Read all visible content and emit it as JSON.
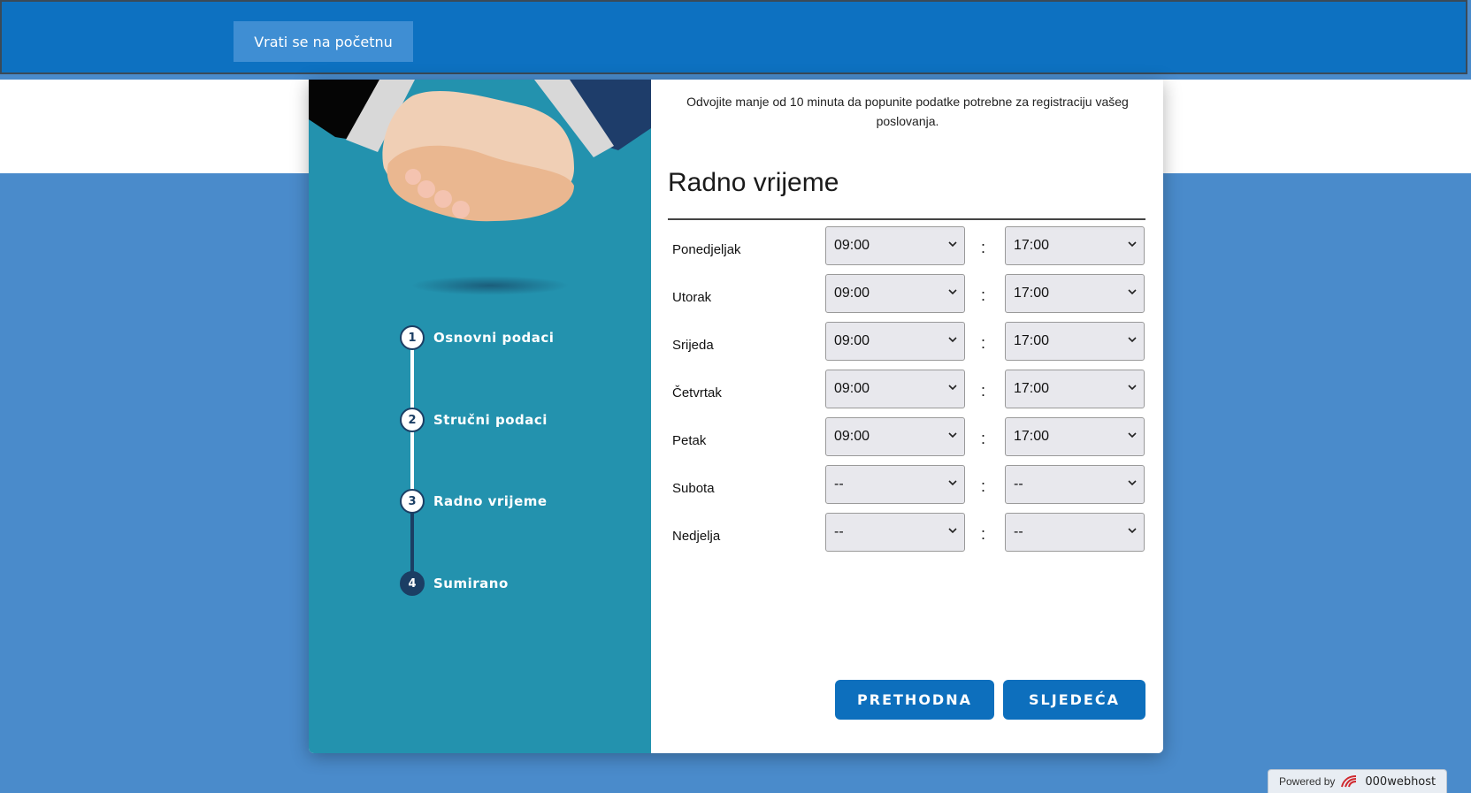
{
  "header": {
    "home_button": "Vrati se na početnu"
  },
  "steps": [
    {
      "number": "1",
      "label": "Osnovni podaci",
      "state": "done"
    },
    {
      "number": "2",
      "label": "Stručni podaci",
      "state": "done"
    },
    {
      "number": "3",
      "label": "Radno vrijeme",
      "state": "done"
    },
    {
      "number": "4",
      "label": "Sumirano",
      "state": "todo"
    }
  ],
  "form": {
    "intro": "Odvojite manje od 10 minuta da popunite podatke potrebne za registraciju vašeg poslovanja.",
    "title": "Radno vrijeme",
    "separator": ":",
    "days": [
      {
        "day": "Ponedjeljak",
        "from": "09:00",
        "to": "17:00"
      },
      {
        "day": "Utorak",
        "from": "09:00",
        "to": "17:00"
      },
      {
        "day": "Srijeda",
        "from": "09:00",
        "to": "17:00"
      },
      {
        "day": "Četvrtak",
        "from": "09:00",
        "to": "17:00"
      },
      {
        "day": "Petak",
        "from": "09:00",
        "to": "17:00"
      },
      {
        "day": "Subota",
        "from": "--",
        "to": "--"
      },
      {
        "day": "Nedjelja",
        "from": "--",
        "to": "--"
      }
    ],
    "prev_button": "PRETHODNA",
    "next_button": "SLJEDEĆA"
  },
  "footer": {
    "powered_by": "Powered by",
    "brand": "000webhost",
    "brand_icon": "000webhost-logo-icon"
  },
  "colors": {
    "topbar": "#0d71c1",
    "panel": "#2392ae",
    "button": "#0d6fbd",
    "page_bg": "#4a8bcb",
    "step_dark": "#1b3e64"
  }
}
